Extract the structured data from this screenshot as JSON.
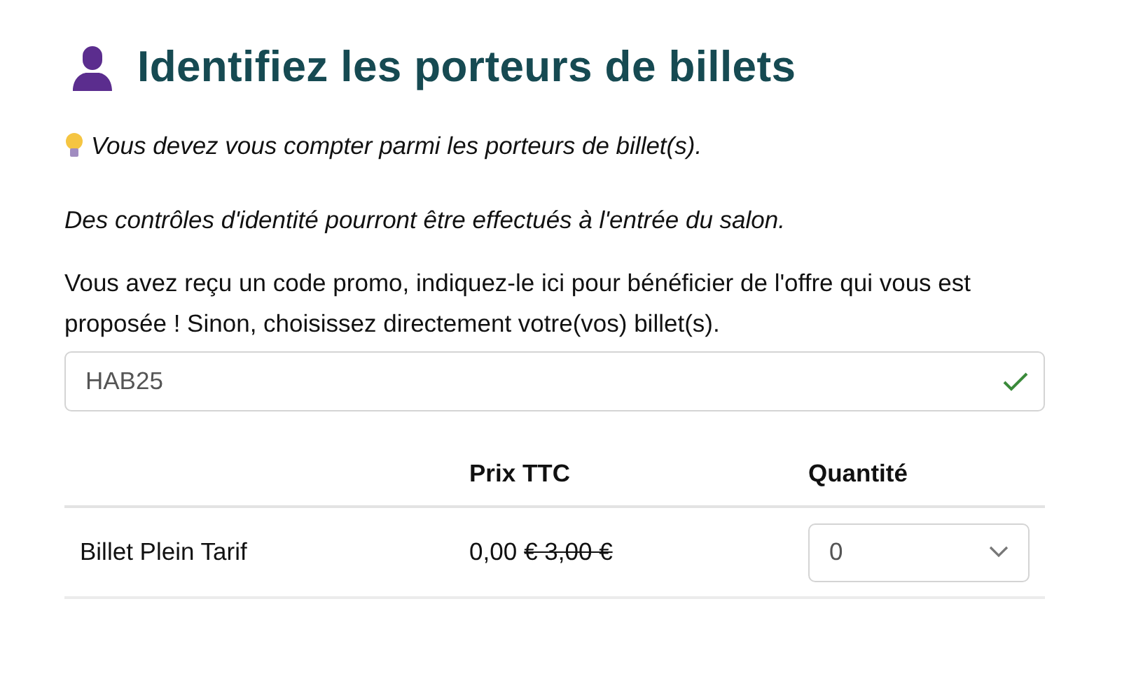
{
  "heading": {
    "title": "Identifiez les porteurs de billets"
  },
  "tip": "Vous devez vous compter parmi les porteurs de billet(s).",
  "notice": "Des contrôles d'identité pourront être effectués à l'entrée du salon.",
  "promo": {
    "instructions": "Vous avez reçu un code promo, indiquez-le ici pour bénéficier de l'offre qui vous est proposée ! Sinon, choisissez directement votre(vos) billet(s).",
    "value": "HAB25",
    "valid": true
  },
  "table": {
    "columns": [
      "Prix TTC",
      "Quantité"
    ],
    "rows": [
      {
        "name": "Billet Plein Tarif",
        "price": "0,00",
        "old_price": "€ 3,00 €",
        "quantity": "0"
      }
    ]
  }
}
